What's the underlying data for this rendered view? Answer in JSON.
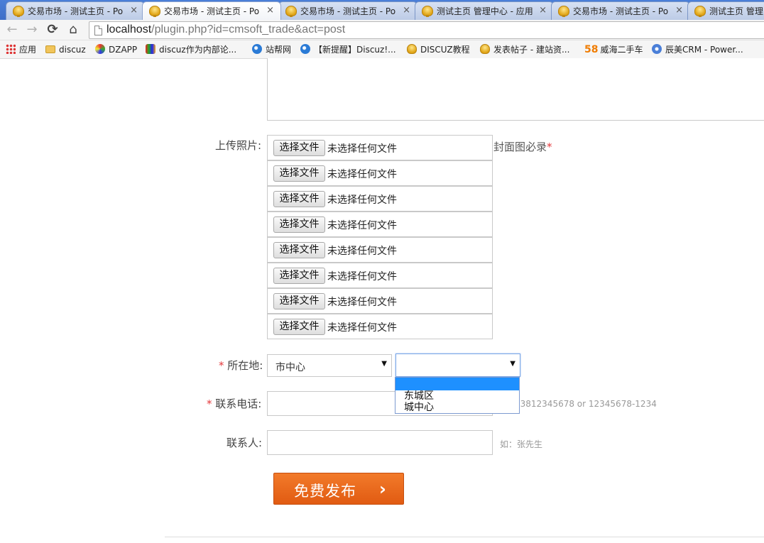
{
  "tabs": [
    {
      "title": "交易市场 - 测试主页 - Po",
      "close": "×"
    },
    {
      "title": "交易市场 - 测试主页 - Po",
      "close": "×"
    },
    {
      "title": "交易市场 - 测试主页 - Po",
      "close": "×"
    },
    {
      "title": "测试主页 管理中心 - 应用",
      "close": "×"
    },
    {
      "title": "交易市场 - 测试主页 - Po",
      "close": "×"
    },
    {
      "title": "测试主页 管理中",
      "close": ""
    }
  ],
  "toolbar": {
    "back": "←",
    "forward": "→",
    "reload": "⟳",
    "home": "⌂",
    "url_host": "localhost",
    "url_path": "/plugin.php?id=cmsoft_trade&act=post"
  },
  "bookmarks": [
    {
      "label": "应用",
      "icon": "apps-grid-icon"
    },
    {
      "label": "discuz",
      "icon": "folder-icon"
    },
    {
      "label": "DZAPP",
      "icon": "dzapp-icon"
    },
    {
      "label": "discuz作为内部论...",
      "icon": "multicolor-icon"
    },
    {
      "label": "站帮网",
      "icon": "ie-icon"
    },
    {
      "label": "【新提醒】Discuz!...",
      "icon": "ie-icon"
    },
    {
      "label": "DISCUZ教程",
      "icon": "trophy-icon"
    },
    {
      "label": "发表帖子 - 建站资...",
      "icon": "trophy-icon"
    },
    {
      "label": "威海二手车",
      "icon": "58-icon",
      "badge": "58"
    },
    {
      "label": "辰美CRM - Power...",
      "icon": "crm-icon"
    }
  ],
  "form": {
    "upload_label": "上传照片:",
    "file_button": "选择文件",
    "file_status": "未选择任何文件",
    "file_rows": 8,
    "cover_note": "封面图必录",
    "required_mark": "*",
    "location_label": "所在地:",
    "location_city": "市中心",
    "location_district": "",
    "district_options": [
      "",
      "东城区",
      "城中心"
    ],
    "phone_label": "联系电话:",
    "phone_value": "",
    "phone_hint": "13812345678 or 12345678-1234",
    "contact_label": "联系人:",
    "contact_value": "",
    "contact_hint": "如：张先生",
    "submit_label": "免费发布",
    "submit_arrow": "›"
  },
  "colors": {
    "accent_orange": "#e8651c",
    "required_red": "#e4393c",
    "dropdown_highlight": "#1e90ff",
    "tabbar_blue": "#4a7fd8"
  }
}
